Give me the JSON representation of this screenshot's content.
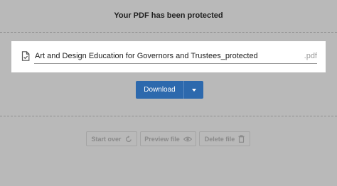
{
  "header": {
    "title": "Your PDF has been protected"
  },
  "file": {
    "name": "Art and Design Education for Governors and Trustees_protected",
    "extension": ".pdf",
    "icon": "file-check-icon"
  },
  "download": {
    "label": "Download",
    "dropdown_icon": "caret-down-icon",
    "color": "#2d69ad"
  },
  "actions": {
    "start_over": {
      "label": "Start over",
      "icon": "refresh-icon"
    },
    "preview_file": {
      "label": "Preview file",
      "icon": "eye-icon"
    },
    "delete_file": {
      "label": "Delete file",
      "icon": "trash-icon"
    }
  }
}
